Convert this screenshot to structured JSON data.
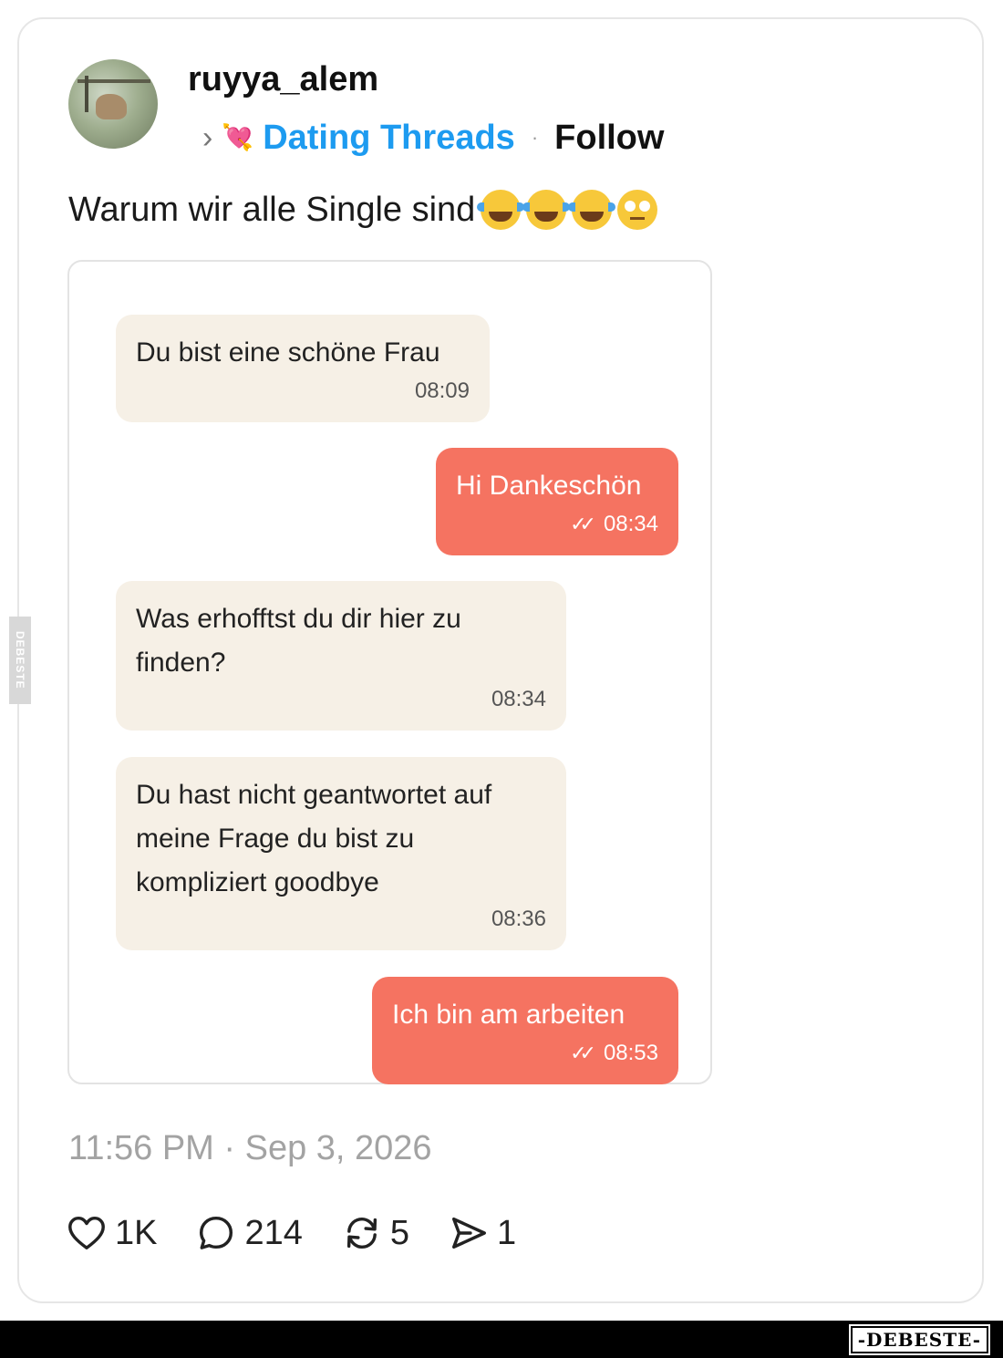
{
  "post": {
    "username": "ruyya_alem",
    "topic_chevron": "›",
    "topic_icon": "💘",
    "topic": "Dating Threads",
    "separator": "·",
    "follow_label": "Follow",
    "caption": "Warum wir alle Single sind",
    "caption_emojis": [
      "face-with-tears-of-joy-icon",
      "face-with-tears-of-joy-icon",
      "face-with-tears-of-joy-icon",
      "face-with-rolling-eyes-icon"
    ],
    "timestamp": "11:56 PM · Sep 3, 2026"
  },
  "chat": {
    "messages": [
      {
        "direction": "incoming",
        "text": "Du bist eine schöne Frau",
        "time": "08:09"
      },
      {
        "direction": "outgoing",
        "text": "Hi Dankeschön",
        "time": "08:34",
        "read_icon": "double-check-icon"
      },
      {
        "direction": "incoming",
        "text": "Was erhofftst du dir hier zu finden?",
        "time": "08:34"
      },
      {
        "direction": "incoming",
        "text": "Du hast nicht geantwortet auf meine Frage du bist zu kompliziert goodbye",
        "time": "08:36"
      },
      {
        "direction": "outgoing",
        "text": "Ich bin am arbeiten",
        "time": "08:53",
        "read_icon": "double-check-icon"
      }
    ],
    "colors": {
      "incoming_bg": "#f6f0e6",
      "outgoing_bg": "#f57361"
    }
  },
  "actions": {
    "likes": "1K",
    "replies": "214",
    "reposts": "5",
    "shares": "1"
  },
  "watermark": {
    "logo": "-DEBESTE-",
    "side": "DEBESTE"
  },
  "colors": {
    "topic": "#1d9bf0",
    "timestamp": "#a3a3a3"
  }
}
